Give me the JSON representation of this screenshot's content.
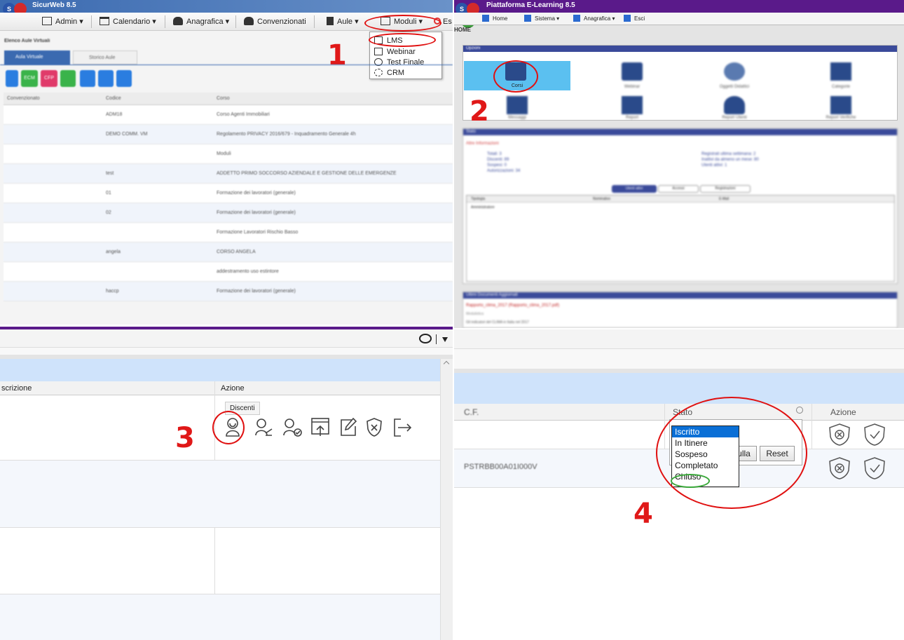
{
  "q1": {
    "title": "SicurWeb 8.5",
    "menu": [
      "Admin ▾",
      "Calendario ▾",
      "Anagrafica ▾",
      "Convenzionati",
      "Aule ▾",
      "Moduli ▾",
      "Es"
    ],
    "breadcrumb": "Elenco Aule Virtuali",
    "tabs": [
      "Aula Virtuale",
      "Storico Aule"
    ],
    "columns": [
      "Convenzionato",
      "Codice",
      "Corso"
    ],
    "rows": [
      [
        "",
        "ADM18",
        "Corso Agenti Immobiliari"
      ],
      [
        "",
        "DEMO COMM. VM",
        "Regolamento PRIVACY 2016/679 - Inquadramento Generale 4h"
      ],
      [
        "",
        "",
        "Moduli"
      ],
      [
        "",
        "test",
        "ADDETTO PRIMO SOCCORSO AZIENDALE E GESTIONE DELLE EMERGENZE"
      ],
      [
        "",
        "01",
        "Formazione dei lavoratori (generale)"
      ],
      [
        "",
        "02",
        "Formazione dei lavoratori (generale)"
      ],
      [
        "",
        "",
        "Formazione Lavoratori Rischio Basso"
      ],
      [
        "",
        "angela",
        "CORSO ANGELA"
      ],
      [
        "",
        "",
        "addestramento uso estintore"
      ],
      [
        "",
        "haccp",
        "Formazione dei lavoratori (generale)"
      ]
    ],
    "dropdown": [
      "LMS",
      "Webinar",
      "Test Finale",
      "CRM"
    ],
    "toolbar_labels": [
      "ECM",
      "CFP"
    ],
    "step": "1"
  },
  "q2": {
    "title": "Piattaforma E-Learning 8.5",
    "menu": [
      "Home",
      "Sistema ▾",
      "Anagrafica ▾",
      "Esci"
    ],
    "home": "HOME",
    "options_title": "Opzioni",
    "cards": [
      "Corsi",
      "Webinar",
      "Oggetti Didattici",
      "Categorie",
      "Messaggi",
      "Report",
      "Report Utenti",
      "Report Verifiche"
    ],
    "panel2_title": "Stato",
    "panel2_sub": "Altre Informazioni",
    "stats_left": [
      "Totali: 3",
      "Discenti: 89",
      "Sospesi: 0",
      "Autorizzazioni: 34"
    ],
    "stats_right": [
      "Registrati ultima settimana: 2",
      "Inattivi da almeno un mese: 80",
      "Utenti attivi: 1"
    ],
    "subtabs": [
      "Utenti attivi",
      "Accessi",
      "Registrazioni"
    ],
    "table_cols": [
      "Tipologia",
      "Nominativo",
      "E-Mail"
    ],
    "table_row": "Amministratore",
    "panel3_title": "Ultimi Documenti Aggiornati",
    "doc_link": "Rapporto_clima_2017 (Rapporto_clima_2017.pdf)",
    "doc_type": "Modulistica",
    "doc_desc": "Gli indicatori del CLIMA in Italia nel 2017",
    "step": "2"
  },
  "q3": {
    "col1": "scrizione",
    "col2": "Azione",
    "tooltip": "Discenti",
    "step": "3"
  },
  "q4": {
    "col_cf": "C.F.",
    "col_stato": "Stato",
    "col_azione": "Azione",
    "cf_value": "PSTRBB00A01I000V",
    "options": [
      "Iscritto",
      "In Itinere",
      "Sospeso",
      "Completato",
      "Chiuso"
    ],
    "btn_annulla": "ulla",
    "btn_reset": "Reset",
    "step": "4"
  },
  "colors": {
    "accent_red": "#e01010",
    "purple": "#5a1a8a",
    "blue_panel": "#3a4a9a",
    "selected": "#0a6fd6",
    "highlight": "#5bc0f0"
  }
}
